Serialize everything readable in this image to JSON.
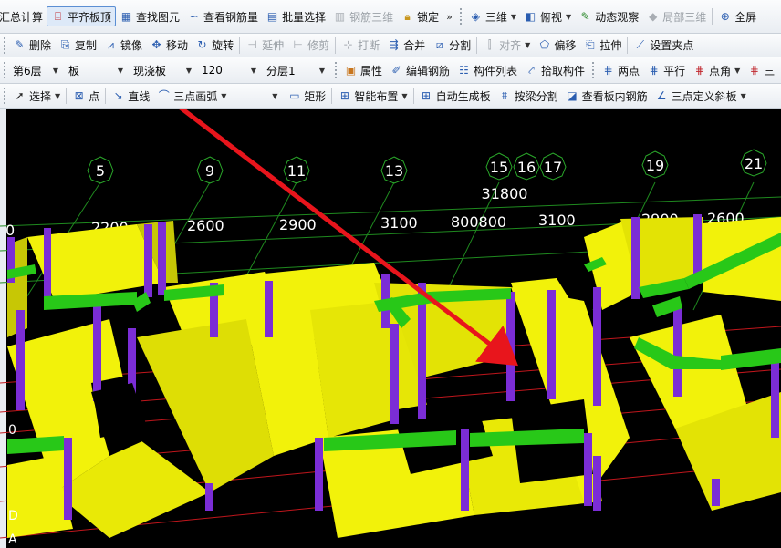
{
  "toolbar1": {
    "items": [
      {
        "label": "汇总计算",
        "icon": "summary-calc-icon",
        "state": "normal"
      },
      {
        "label": "平齐板顶",
        "icon": "align-slab-top-icon",
        "state": "active"
      },
      {
        "label": "查找图元",
        "icon": "find-element-icon",
        "state": "normal"
      },
      {
        "label": "查看钢筋量",
        "icon": "view-rebar-qty-icon",
        "state": "normal"
      },
      {
        "label": "批量选择",
        "icon": "batch-select-icon",
        "state": "normal"
      },
      {
        "label": "钢筋三维",
        "icon": "rebar-3d-icon",
        "state": "disabled"
      },
      {
        "label": "锁定",
        "icon": "lock-icon",
        "state": "normal"
      }
    ],
    "more": "»",
    "view_items": [
      {
        "label": "三维",
        "icon": "3d-cube-icon",
        "dropdown": true,
        "state": "normal"
      },
      {
        "label": "俯视",
        "icon": "top-view-icon",
        "dropdown": true,
        "state": "normal"
      },
      {
        "label": "动态观察",
        "icon": "orbit-icon",
        "dropdown": false,
        "state": "normal"
      },
      {
        "label": "局部三维",
        "icon": "partial-3d-icon",
        "dropdown": false,
        "state": "disabled"
      },
      {
        "label": "全屏",
        "icon": "fullscreen-icon",
        "dropdown": false,
        "state": "normal"
      }
    ]
  },
  "toolbar2": {
    "items": [
      {
        "label": "删除",
        "icon": "delete-icon",
        "state": "normal"
      },
      {
        "label": "复制",
        "icon": "copy-icon",
        "state": "normal"
      },
      {
        "label": "镜像",
        "icon": "mirror-icon",
        "state": "normal"
      },
      {
        "label": "移动",
        "icon": "move-icon",
        "state": "normal"
      },
      {
        "label": "旋转",
        "icon": "rotate-icon",
        "state": "normal"
      },
      {
        "label": "延伸",
        "icon": "extend-icon",
        "state": "disabled"
      },
      {
        "label": "修剪",
        "icon": "trim-icon",
        "state": "disabled"
      },
      {
        "label": "打断",
        "icon": "break-icon",
        "state": "disabled"
      },
      {
        "label": "合并",
        "icon": "merge-icon",
        "state": "normal"
      },
      {
        "label": "分割",
        "icon": "split-icon",
        "state": "normal"
      },
      {
        "label": "对齐",
        "icon": "align-icon",
        "state": "disabled"
      },
      {
        "label": "偏移",
        "icon": "offset-icon",
        "state": "normal"
      },
      {
        "label": "拉伸",
        "icon": "stretch-icon",
        "state": "normal"
      },
      {
        "label": "设置夹点",
        "icon": "grip-point-icon",
        "state": "normal"
      }
    ]
  },
  "toolbar3": {
    "floor": "第6层",
    "category": "板",
    "type": "现浇板",
    "thickness": "120",
    "layer": "分层1",
    "items": [
      {
        "label": "属性",
        "icon": "properties-icon"
      },
      {
        "label": "编辑钢筋",
        "icon": "edit-rebar-icon"
      },
      {
        "label": "构件列表",
        "icon": "component-list-icon"
      },
      {
        "label": "拾取构件",
        "icon": "pick-component-icon"
      }
    ],
    "snap_items": [
      {
        "label": "两点",
        "icon": "two-point-icon"
      },
      {
        "label": "平行",
        "icon": "parallel-icon"
      },
      {
        "label": "点角",
        "icon": "point-angle-icon"
      },
      {
        "label": "三",
        "icon": "three-point-icon"
      }
    ]
  },
  "toolbar4": {
    "items": [
      {
        "label": "选择",
        "icon": "select-arrow-icon",
        "dropdown": true
      },
      {
        "label": "点",
        "icon": "point-icon",
        "dropdown": false
      },
      {
        "label": "直线",
        "icon": "line-icon",
        "dropdown": false
      },
      {
        "label": "三点画弧",
        "icon": "arc-icon",
        "dropdown": true
      }
    ],
    "draw_value": "",
    "items2": [
      {
        "label": "矩形",
        "icon": "rectangle-icon",
        "dropdown": false
      },
      {
        "label": "智能布置",
        "icon": "smart-layout-icon",
        "dropdown": true
      },
      {
        "label": "自动生成板",
        "icon": "auto-slab-icon",
        "dropdown": false
      },
      {
        "label": "按梁分割",
        "icon": "split-by-beam-icon",
        "dropdown": false
      },
      {
        "label": "查看板内钢筋",
        "icon": "view-slab-rebar-icon",
        "dropdown": false
      },
      {
        "label": "三点定义斜板",
        "icon": "slope-slab-icon",
        "dropdown": true
      }
    ]
  },
  "viewport": {
    "axis_numbers": [
      "5",
      "9",
      "11",
      "13",
      "15",
      "16",
      "17",
      "19",
      "21"
    ],
    "total_dimension": "31800",
    "dimensions": [
      "0",
      "2200",
      "2600",
      "2900",
      "3100",
      "800800",
      "3100",
      "2900",
      "2600"
    ],
    "row_labels": [
      "0",
      "D",
      "A"
    ]
  },
  "colors": {
    "background": "#000000",
    "wall": "#f2f20a",
    "wall_shade": "#b9b903",
    "column": "#7b2dd6",
    "beam": "#28c818",
    "annotation_arrow": "#e8151c",
    "grid_green": "#1f8a1f",
    "grid_red": "#c0161c"
  }
}
